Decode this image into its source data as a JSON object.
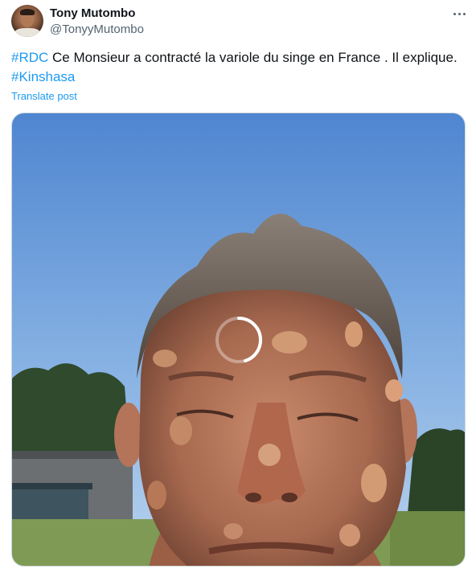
{
  "author": {
    "display_name": "Tony Mutombo",
    "handle": "@TonyyMutombo"
  },
  "post": {
    "hashtag_1": "#RDC",
    "text": " Ce Monsieur a contracté la variole du singe en France . Il explique.",
    "hashtag_2": "#Kinshasa",
    "translate_label": "Translate post"
  },
  "media": {
    "type": "video",
    "state": "loading"
  },
  "icons": {
    "more": "more-horizontal-icon",
    "spinner": "loading-spinner-icon"
  },
  "colors": {
    "link": "#1d9bf0",
    "text": "#0f1419",
    "secondary": "#536471"
  }
}
